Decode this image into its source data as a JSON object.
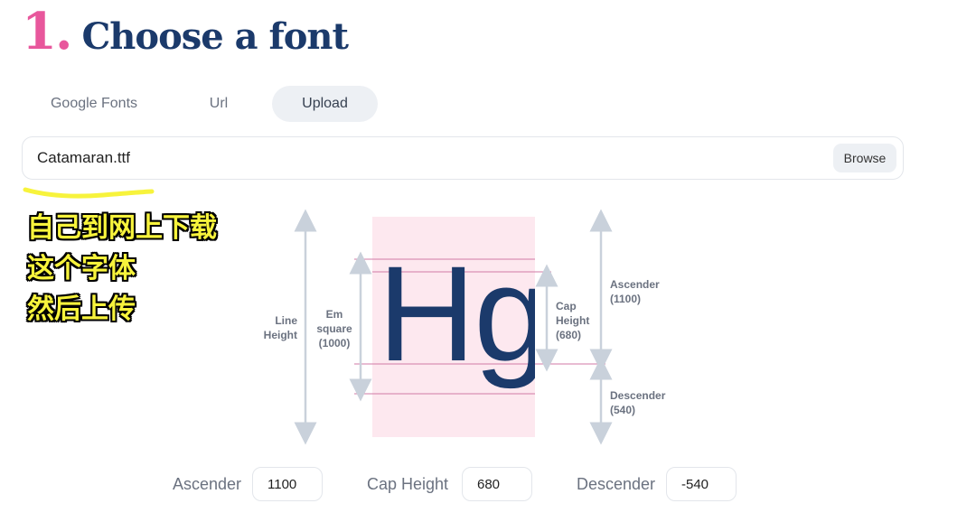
{
  "heading": {
    "step": "1.",
    "title": "Choose a font"
  },
  "tabs": [
    {
      "label": "Google Fonts",
      "active": false
    },
    {
      "label": "Url",
      "active": false
    },
    {
      "label": "Upload",
      "active": true
    }
  ],
  "file_input": {
    "value": "Catamaran.ttf",
    "browse_label": "Browse"
  },
  "annotation": {
    "lines": [
      "自己到网上下载",
      "这个字体",
      "然后上传"
    ],
    "highlight_color": "#f7f33c"
  },
  "diagram": {
    "line_height": [
      "Line",
      "Height"
    ],
    "em_square": [
      "Em",
      "square",
      "(1000)"
    ],
    "cap_height": [
      "Cap",
      "Height",
      "(680)"
    ],
    "ascender": [
      "Ascender",
      "(1100)"
    ],
    "descender": [
      "Descender",
      "(540)"
    ],
    "sample_text": "Hg",
    "colors": {
      "glyph": "#1b3a6b",
      "box": "#fde8ef",
      "guide": "#d17aa6",
      "arrow": "#c9d1db"
    }
  },
  "metrics": {
    "ascender": {
      "label": "Ascender",
      "value": "1100"
    },
    "cap_height": {
      "label": "Cap Height",
      "value": "680"
    },
    "descender": {
      "label": "Descender",
      "value": "-540"
    }
  },
  "colors": {
    "accent_pink": "#e8579c",
    "title_navy": "#1b3a6b"
  }
}
